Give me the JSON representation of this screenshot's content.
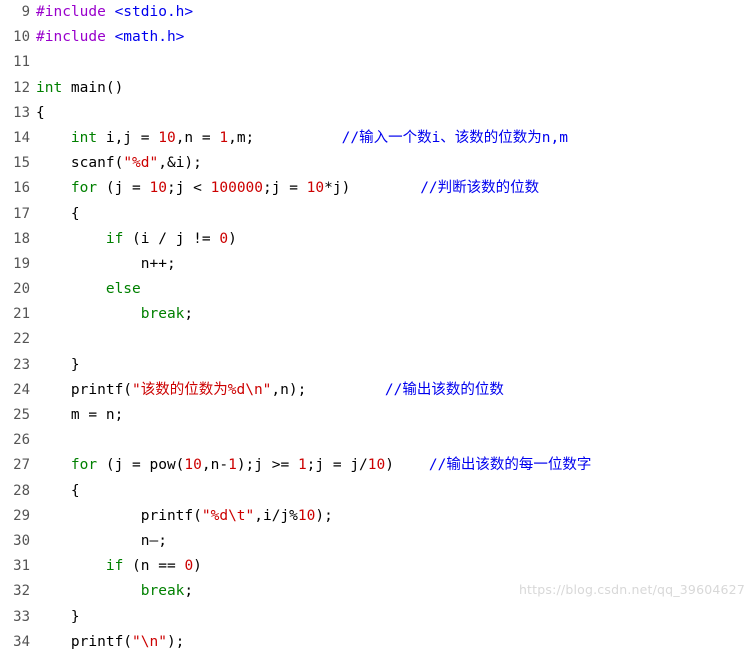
{
  "editor": {
    "watermark": "https://blog.csdn.net/qq_39604627",
    "colors": {
      "keyword": "#008000",
      "string": "#cc0000",
      "preprocessor": "#9900cc",
      "comment": "#0000ee",
      "number": "#cc0000",
      "plain": "#000000",
      "gutter": "#555555",
      "background": "#ffffff"
    },
    "lines": [
      {
        "number": "9",
        "tokens": [
          {
            "t": "#include ",
            "c": "pre"
          },
          {
            "t": "<stdio.h>",
            "c": "cmt"
          }
        ]
      },
      {
        "number": "10",
        "tokens": [
          {
            "t": "#include ",
            "c": "pre"
          },
          {
            "t": "<math.h>",
            "c": "cmt"
          }
        ]
      },
      {
        "number": "11",
        "tokens": []
      },
      {
        "number": "12",
        "tokens": [
          {
            "t": "int ",
            "c": "kw"
          },
          {
            "t": "main()",
            "c": "plain"
          }
        ]
      },
      {
        "number": "13",
        "tokens": [
          {
            "t": "{",
            "c": "plain"
          }
        ]
      },
      {
        "number": "14",
        "tokens": [
          {
            "t": "    ",
            "c": "plain"
          },
          {
            "t": "int ",
            "c": "kw"
          },
          {
            "t": "i,j = ",
            "c": "plain"
          },
          {
            "t": "10",
            "c": "num"
          },
          {
            "t": ",n = ",
            "c": "plain"
          },
          {
            "t": "1",
            "c": "num"
          },
          {
            "t": ",m;",
            "c": "plain"
          },
          {
            "t": "          ",
            "c": "plain"
          },
          {
            "t": "//输入一个数i、该数的位数为n,m",
            "c": "cmt"
          }
        ]
      },
      {
        "number": "15",
        "tokens": [
          {
            "t": "    scanf(",
            "c": "plain"
          },
          {
            "t": "\"%d\"",
            "c": "str"
          },
          {
            "t": ",&i);",
            "c": "plain"
          }
        ]
      },
      {
        "number": "16",
        "tokens": [
          {
            "t": "    ",
            "c": "plain"
          },
          {
            "t": "for ",
            "c": "kw"
          },
          {
            "t": "(j = ",
            "c": "plain"
          },
          {
            "t": "10",
            "c": "num"
          },
          {
            "t": ";j < ",
            "c": "plain"
          },
          {
            "t": "100000",
            "c": "num"
          },
          {
            "t": ";j = ",
            "c": "plain"
          },
          {
            "t": "10",
            "c": "num"
          },
          {
            "t": "*",
            "c": "plain"
          },
          {
            "t": "j)",
            "c": "plain"
          },
          {
            "t": "        ",
            "c": "plain"
          },
          {
            "t": "//判断该数的位数",
            "c": "cmt"
          }
        ]
      },
      {
        "number": "17",
        "tokens": [
          {
            "t": "    {",
            "c": "plain"
          }
        ]
      },
      {
        "number": "18",
        "tokens": [
          {
            "t": "        ",
            "c": "plain"
          },
          {
            "t": "if ",
            "c": "kw"
          },
          {
            "t": "(i / j != ",
            "c": "plain"
          },
          {
            "t": "0",
            "c": "num"
          },
          {
            "t": ")",
            "c": "plain"
          }
        ]
      },
      {
        "number": "19",
        "tokens": [
          {
            "t": "            n++;",
            "c": "plain"
          }
        ]
      },
      {
        "number": "20",
        "tokens": [
          {
            "t": "        ",
            "c": "plain"
          },
          {
            "t": "else",
            "c": "kw"
          }
        ]
      },
      {
        "number": "21",
        "tokens": [
          {
            "t": "            ",
            "c": "plain"
          },
          {
            "t": "break",
            "c": "kw"
          },
          {
            "t": ";",
            "c": "plain"
          }
        ]
      },
      {
        "number": "22",
        "tokens": []
      },
      {
        "number": "23",
        "tokens": [
          {
            "t": "    }",
            "c": "plain"
          }
        ]
      },
      {
        "number": "24",
        "tokens": [
          {
            "t": "    printf(",
            "c": "plain"
          },
          {
            "t": "\"该数的位数为%d\\n\"",
            "c": "str"
          },
          {
            "t": ",n);",
            "c": "plain"
          },
          {
            "t": "         ",
            "c": "plain"
          },
          {
            "t": "//输出该数的位数",
            "c": "cmt"
          }
        ]
      },
      {
        "number": "25",
        "tokens": [
          {
            "t": "    m = n;",
            "c": "plain"
          }
        ]
      },
      {
        "number": "26",
        "tokens": []
      },
      {
        "number": "27",
        "tokens": [
          {
            "t": "    ",
            "c": "plain"
          },
          {
            "t": "for ",
            "c": "kw"
          },
          {
            "t": "(j = pow(",
            "c": "plain"
          },
          {
            "t": "10",
            "c": "num"
          },
          {
            "t": ",n-",
            "c": "plain"
          },
          {
            "t": "1",
            "c": "num"
          },
          {
            "t": ");j >= ",
            "c": "plain"
          },
          {
            "t": "1",
            "c": "num"
          },
          {
            "t": ";j = j/",
            "c": "plain"
          },
          {
            "t": "10",
            "c": "num"
          },
          {
            "t": ")",
            "c": "plain"
          },
          {
            "t": "    ",
            "c": "plain"
          },
          {
            "t": "//输出该数的每一位数字",
            "c": "cmt"
          }
        ]
      },
      {
        "number": "28",
        "tokens": [
          {
            "t": "    {",
            "c": "plain"
          }
        ]
      },
      {
        "number": "29",
        "tokens": [
          {
            "t": "            printf(",
            "c": "plain"
          },
          {
            "t": "\"%d\\t\"",
            "c": "str"
          },
          {
            "t": ",i/j%",
            "c": "plain"
          },
          {
            "t": "10",
            "c": "num"
          },
          {
            "t": ");",
            "c": "plain"
          }
        ]
      },
      {
        "number": "30",
        "tokens": [
          {
            "t": "            n—;",
            "c": "plain"
          }
        ]
      },
      {
        "number": "31",
        "tokens": [
          {
            "t": "        ",
            "c": "plain"
          },
          {
            "t": "if ",
            "c": "kw"
          },
          {
            "t": "(n == ",
            "c": "plain"
          },
          {
            "t": "0",
            "c": "num"
          },
          {
            "t": ")",
            "c": "plain"
          }
        ]
      },
      {
        "number": "32",
        "tokens": [
          {
            "t": "            ",
            "c": "plain"
          },
          {
            "t": "break",
            "c": "kw"
          },
          {
            "t": ";",
            "c": "plain"
          }
        ]
      },
      {
        "number": "33",
        "tokens": [
          {
            "t": "    }",
            "c": "plain"
          }
        ]
      },
      {
        "number": "34",
        "tokens": [
          {
            "t": "    printf(",
            "c": "plain"
          },
          {
            "t": "\"\\n\"",
            "c": "str"
          },
          {
            "t": ");",
            "c": "plain"
          }
        ]
      }
    ]
  }
}
